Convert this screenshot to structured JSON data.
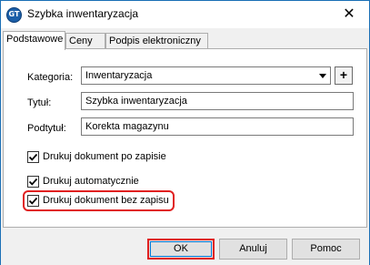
{
  "window": {
    "title": "Szybka inwentaryzacja",
    "icon": "app-logo-icon",
    "icon_text": "GT"
  },
  "tabs": [
    {
      "label": "Podstawowe",
      "active": true
    },
    {
      "label": "Ceny",
      "active": false
    },
    {
      "label": "Podpis elektroniczny",
      "active": false
    }
  ],
  "form": {
    "kategoria": {
      "label": "Kategoria:",
      "value": "Inwentaryzacja",
      "add_label": "+"
    },
    "tytul": {
      "label": "Tytuł:",
      "value": "Szybka inwentaryzacja"
    },
    "podtytul": {
      "label": "Podtytuł:",
      "value": "Korekta magazynu"
    }
  },
  "checkboxes": [
    {
      "label": "Drukuj dokument po zapisie",
      "checked": true
    },
    {
      "label": "Drukuj automatycznie",
      "checked": true
    },
    {
      "label": "Drukuj dokument bez zapisu",
      "checked": true
    }
  ],
  "buttons": {
    "ok": "OK",
    "cancel": "Anuluj",
    "help": "Pomoc"
  },
  "colors": {
    "highlight": "#e02020",
    "accent": "#0078d7",
    "title_icon": "#1c5fa8"
  }
}
